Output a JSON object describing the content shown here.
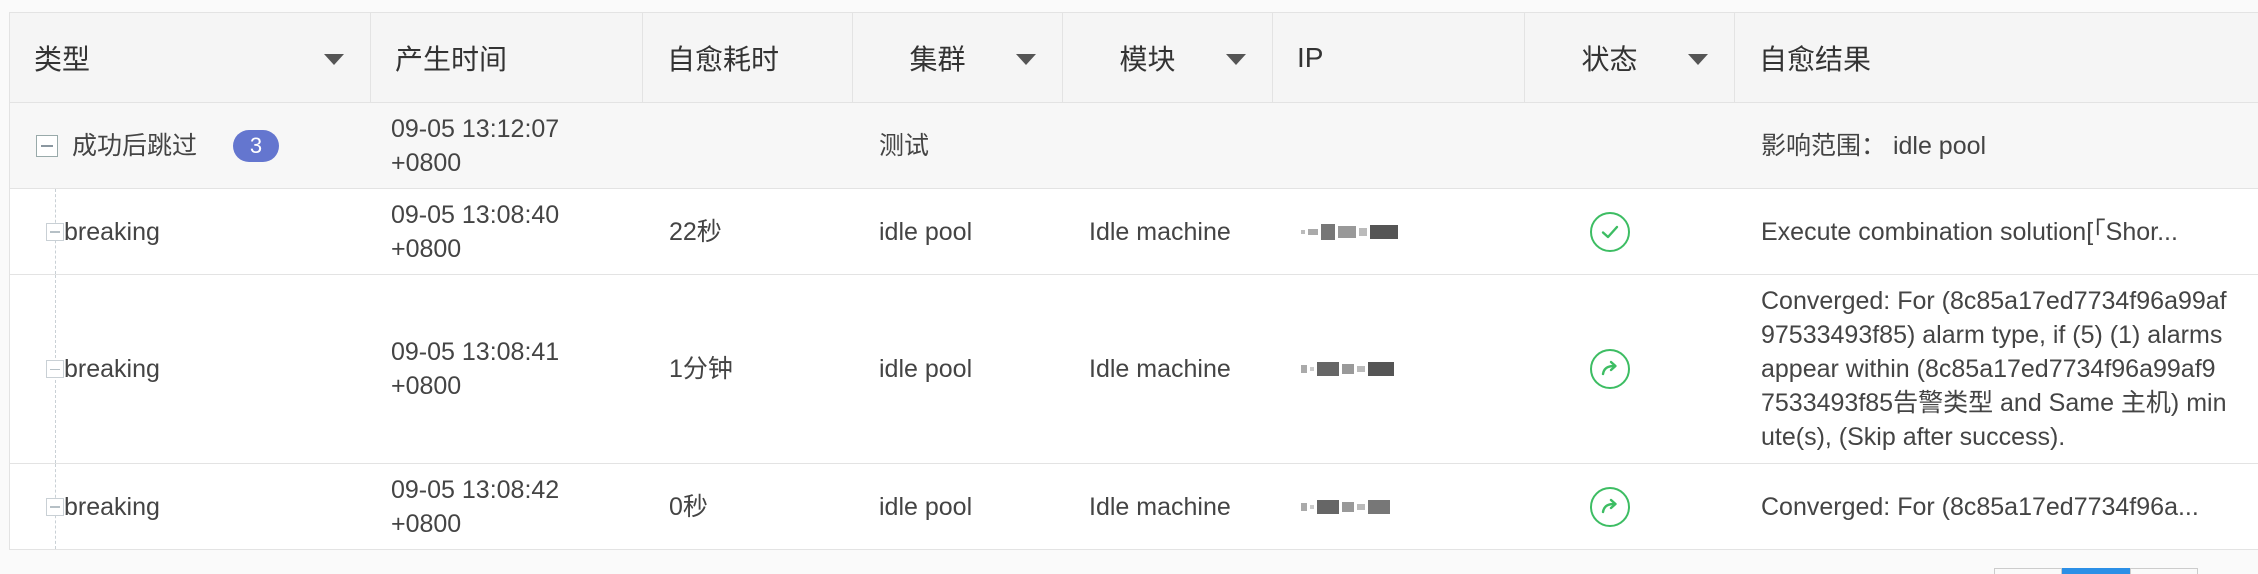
{
  "headers": {
    "type": "类型",
    "time": "产生时间",
    "duration": "自愈耗时",
    "cluster": "集群",
    "module": "模块",
    "ip": "IP",
    "status": "状态",
    "result": "自愈结果"
  },
  "group": {
    "label": "成功后跳过",
    "count": "3",
    "time_line1": "09-05 13:12:07",
    "time_line2": "+0800",
    "cluster": "测试",
    "result": "影响范围： idle pool"
  },
  "rows": [
    {
      "type": "breaking",
      "time_line1": "09-05 13:08:40",
      "time_line2": "+0800",
      "duration": "22秒",
      "cluster": "idle pool",
      "module": "Idle machine",
      "status_icon": "check-circle-icon",
      "result": "Execute combination solution[「Shor..."
    },
    {
      "type": "breaking",
      "time_line1": "09-05 13:08:41",
      "time_line2": "+0800",
      "duration": "1分钟",
      "cluster": "idle pool",
      "module": "Idle machine",
      "status_icon": "converged-arrow-icon",
      "result": "Converged: For (8c85a17ed7734f96a99af97533493f85) alarm type, if (5) (1) alarms appear within (8c85a17ed7734f96a99af97533493f85告警类型 and Same 主机) minute(s), (Skip after success)."
    },
    {
      "type": "breaking",
      "time_line1": "09-05 13:08:42",
      "time_line2": "+0800",
      "duration": "0秒",
      "cluster": "idle pool",
      "module": "Idle machine",
      "status_icon": "converged-arrow-icon",
      "result": "Converged: For (8c85a17ed7734f96a..."
    }
  ],
  "colors": {
    "success": "#3dbd63",
    "badge": "#6476cf",
    "pager_active": "#2c8fe6"
  }
}
